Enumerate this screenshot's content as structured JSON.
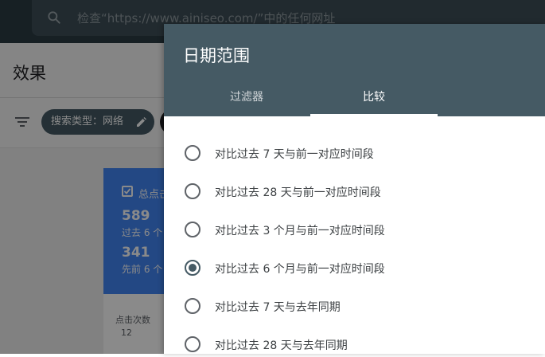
{
  "search": {
    "placeholder": "检查“https://www.ainiseo.com/”中的任何网址"
  },
  "page": {
    "title": "效果"
  },
  "filters": {
    "chip_label": "搜索类型：网络"
  },
  "metric": {
    "label": "总点击",
    "value_current": "589",
    "sub_current": "过去 6 个",
    "value_previous": "341",
    "sub_previous": "先前 6 个"
  },
  "chart": {
    "ylabel": "点击次数",
    "tick_top": "12"
  },
  "dialog": {
    "title": "日期范围",
    "tabs": [
      {
        "label": "过滤器",
        "active": false
      },
      {
        "label": "比较",
        "active": true
      }
    ],
    "options": [
      {
        "label": "对比过去 7 天与前一对应时间段",
        "checked": false
      },
      {
        "label": "对比过去 28 天与前一对应时间段",
        "checked": false
      },
      {
        "label": "对比过去 3 个月与前一对应时间段",
        "checked": false
      },
      {
        "label": "对比过去 6 个月与前一对应时间段",
        "checked": true
      },
      {
        "label": "对比过去 7 天与去年同期",
        "checked": false
      },
      {
        "label": "对比过去 28 天与去年同期",
        "checked": false
      }
    ]
  },
  "colors": {
    "header": "#455a64",
    "topbar": "#2b3b44",
    "metric_card": "#4285f4"
  }
}
